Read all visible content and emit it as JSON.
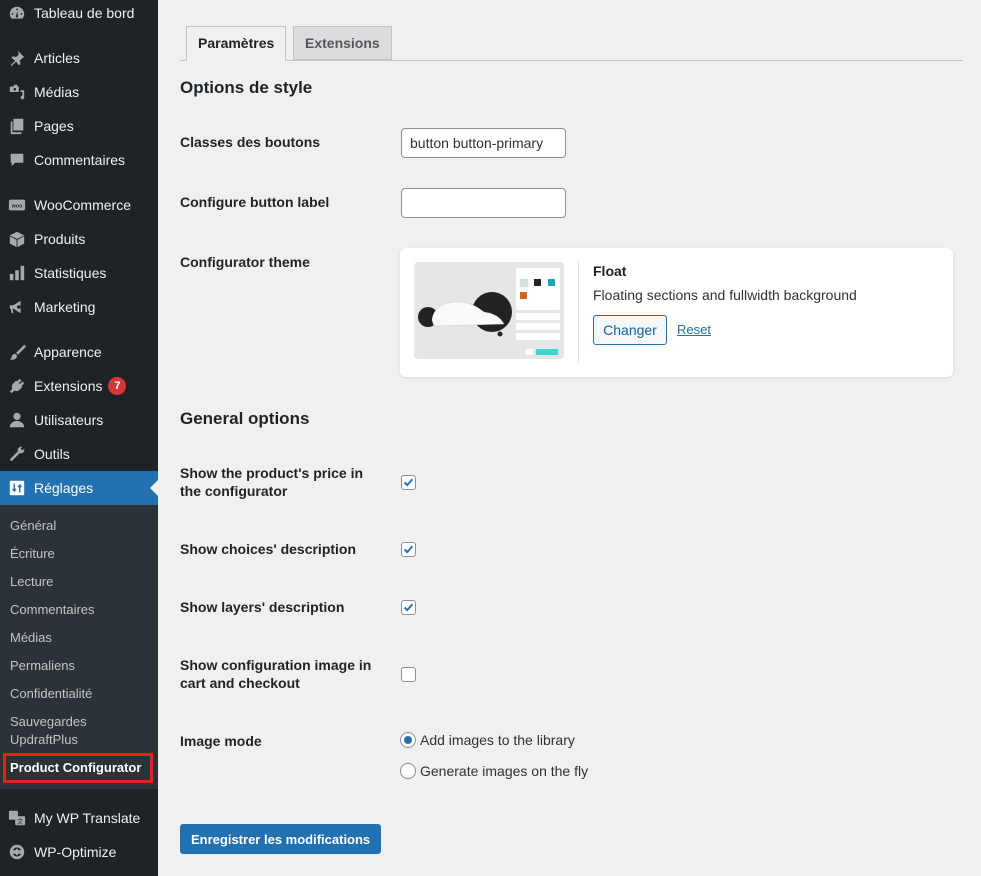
{
  "sidebar": {
    "items": [
      {
        "label": "Tableau de bord",
        "icon": "dashboard-icon"
      },
      {
        "label": "Articles",
        "icon": "pin-icon"
      },
      {
        "label": "Médias",
        "icon": "media-icon"
      },
      {
        "label": "Pages",
        "icon": "pages-icon"
      },
      {
        "label": "Commentaires",
        "icon": "comment-icon"
      },
      {
        "label": "WooCommerce",
        "icon": "woo-icon"
      },
      {
        "label": "Produits",
        "icon": "box-icon"
      },
      {
        "label": "Statistiques",
        "icon": "bar-chart-icon"
      },
      {
        "label": "Marketing",
        "icon": "megaphone-icon"
      },
      {
        "label": "Apparence",
        "icon": "paintbrush-icon"
      },
      {
        "label": "Extensions",
        "icon": "plugin-icon",
        "badge": "7"
      },
      {
        "label": "Utilisateurs",
        "icon": "user-icon"
      },
      {
        "label": "Outils",
        "icon": "wrench-icon"
      },
      {
        "label": "Réglages",
        "icon": "settings-icon",
        "active": true
      },
      {
        "label": "My WP Translate",
        "icon": "translate-icon"
      },
      {
        "label": "WP-Optimize",
        "icon": "optimize-icon"
      }
    ],
    "submenu": [
      {
        "label": "Général"
      },
      {
        "label": "Écriture"
      },
      {
        "label": "Lecture"
      },
      {
        "label": "Commentaires"
      },
      {
        "label": "Médias"
      },
      {
        "label": "Permaliens"
      },
      {
        "label": "Confidentialité"
      },
      {
        "label": "Sauvegardes",
        "label2": "UpdraftPlus"
      },
      {
        "label": "Product Configurator",
        "current": true
      }
    ]
  },
  "tabs": [
    {
      "label": "Paramètres",
      "active": true
    },
    {
      "label": "Extensions",
      "active": false
    }
  ],
  "style_section": {
    "title": "Options de style",
    "button_classes": {
      "label": "Classes des boutons",
      "value": "button button-primary"
    },
    "configure_label": {
      "label": "Configure button label",
      "value": ""
    },
    "theme": {
      "label": "Configurator theme",
      "name": "Float",
      "description": "Floating sections and fullwidth background",
      "change_label": "Changer",
      "reset_label": "Reset"
    }
  },
  "general_section": {
    "title": "General options",
    "options": [
      {
        "label": "Show the product's price in the configurator",
        "checked": true
      },
      {
        "label": "Show choices' description",
        "checked": true
      },
      {
        "label": "Show layers' description",
        "checked": true
      },
      {
        "label": "Show configuration image in cart and checkout",
        "checked": false
      }
    ],
    "image_mode": {
      "label": "Image mode",
      "options": [
        {
          "label": "Add images to the library",
          "selected": true
        },
        {
          "label": "Generate images on the fly",
          "selected": false
        }
      ]
    }
  },
  "save_label": "Enregistrer les modifications",
  "colors": {
    "accent": "#2271b1",
    "sidebar_bg": "#1d2327",
    "badge": "#d63638",
    "highlight": "#e3241b"
  }
}
